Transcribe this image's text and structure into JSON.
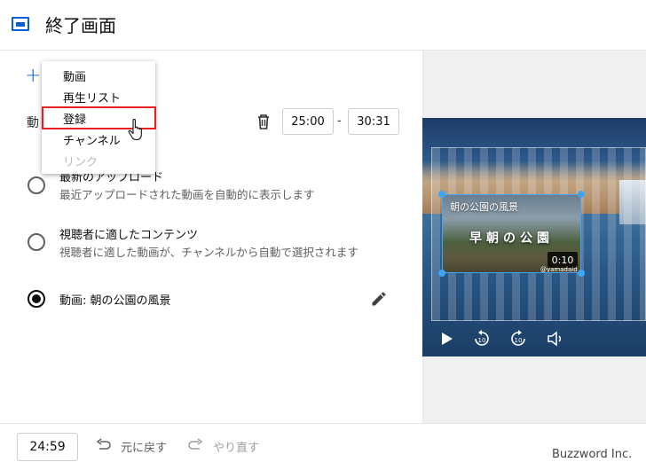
{
  "header": {
    "title": "終了画面"
  },
  "editor": {
    "row_label_partial": "動",
    "start_time": "25:00",
    "separator": "-",
    "end_time": "30:31"
  },
  "menu": {
    "items": [
      {
        "label": "動画",
        "disabled": false
      },
      {
        "label": "再生リスト",
        "disabled": false
      },
      {
        "label": "登録",
        "disabled": false,
        "highlighted": true
      },
      {
        "label": "チャンネル",
        "disabled": false
      },
      {
        "label": "リンク",
        "disabled": true
      }
    ]
  },
  "options": [
    {
      "title": "最新のアップロード",
      "subtitle": "最近アップロードされた動画を自動的に表示します",
      "selected": false
    },
    {
      "title": "視聴者に適したコンテンツ",
      "subtitle": "視聴者に適した動画が、チャンネルから自動で選択されます",
      "selected": false
    },
    {
      "title": "動画: 朝の公園の風景",
      "subtitle": "",
      "selected": true
    }
  ],
  "preview": {
    "element_title": "朝の公園の風景",
    "element_big_text": "早朝の公園",
    "element_duration": "0:10",
    "element_watermark": "@yamadaid"
  },
  "bottom": {
    "time": "24:59",
    "undo_label": "元に戻す",
    "redo_label": "やり直す"
  },
  "watermark": "Buzzword Inc.",
  "colors": {
    "accent": "#065fd4",
    "highlight": "#e32121",
    "selection": "#3ea6ff"
  }
}
